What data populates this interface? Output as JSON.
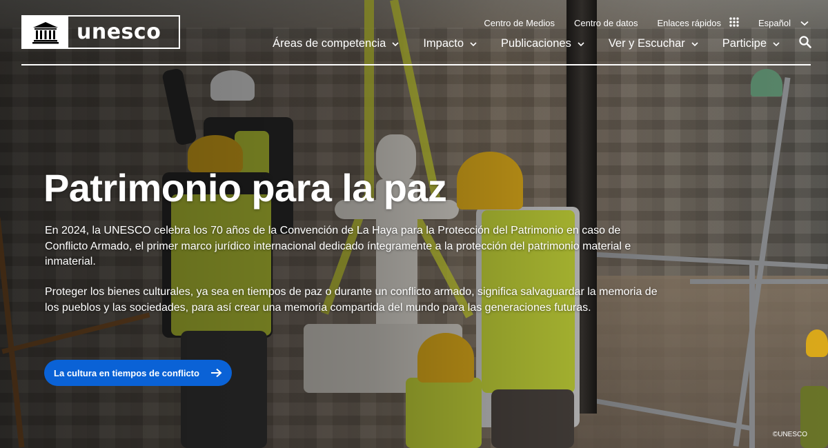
{
  "brand": {
    "wordmark": "unesco",
    "logo_icon": "temple-logo-icon"
  },
  "utility_nav": {
    "media_center": "Centro de Medios",
    "data_center": "Centro de datos",
    "quick_links": "Enlaces rápidos",
    "language": "Español"
  },
  "main_nav": {
    "items": [
      {
        "label": "Áreas de competencia"
      },
      {
        "label": "Impacto"
      },
      {
        "label": "Publicaciones"
      },
      {
        "label": "Ver y Escuchar"
      },
      {
        "label": "Participe"
      }
    ]
  },
  "hero": {
    "title": "Patrimonio para la paz",
    "paragraph_1": "En 2024, la UNESCO celebra los 70 años de la Convención de La Haya para la Protección del Patrimonio en caso de Conflicto Armado, el primer marco jurídico internacional dedicado íntegramente a la protección del patrimonio material e inmaterial.",
    "paragraph_2": "Proteger los bienes culturales, ya sea en tiempos de paz o durante un conflicto armado, significa salvaguardar la memoria de los pueblos y las sociedades, para así crear una memoria compartida del mundo para las generaciones futuras.",
    "cta_label": "La cultura en tiempos de conflicto",
    "credit": "©UNESCO"
  },
  "colors": {
    "cta": "#0a62d6",
    "text": "#ffffff",
    "vest": "#c8d83a",
    "helmet": "#e6b21c"
  },
  "icons": [
    "temple-logo-icon",
    "grid-icon",
    "chevron-down-icon",
    "search-icon",
    "arrow-right-icon"
  ]
}
